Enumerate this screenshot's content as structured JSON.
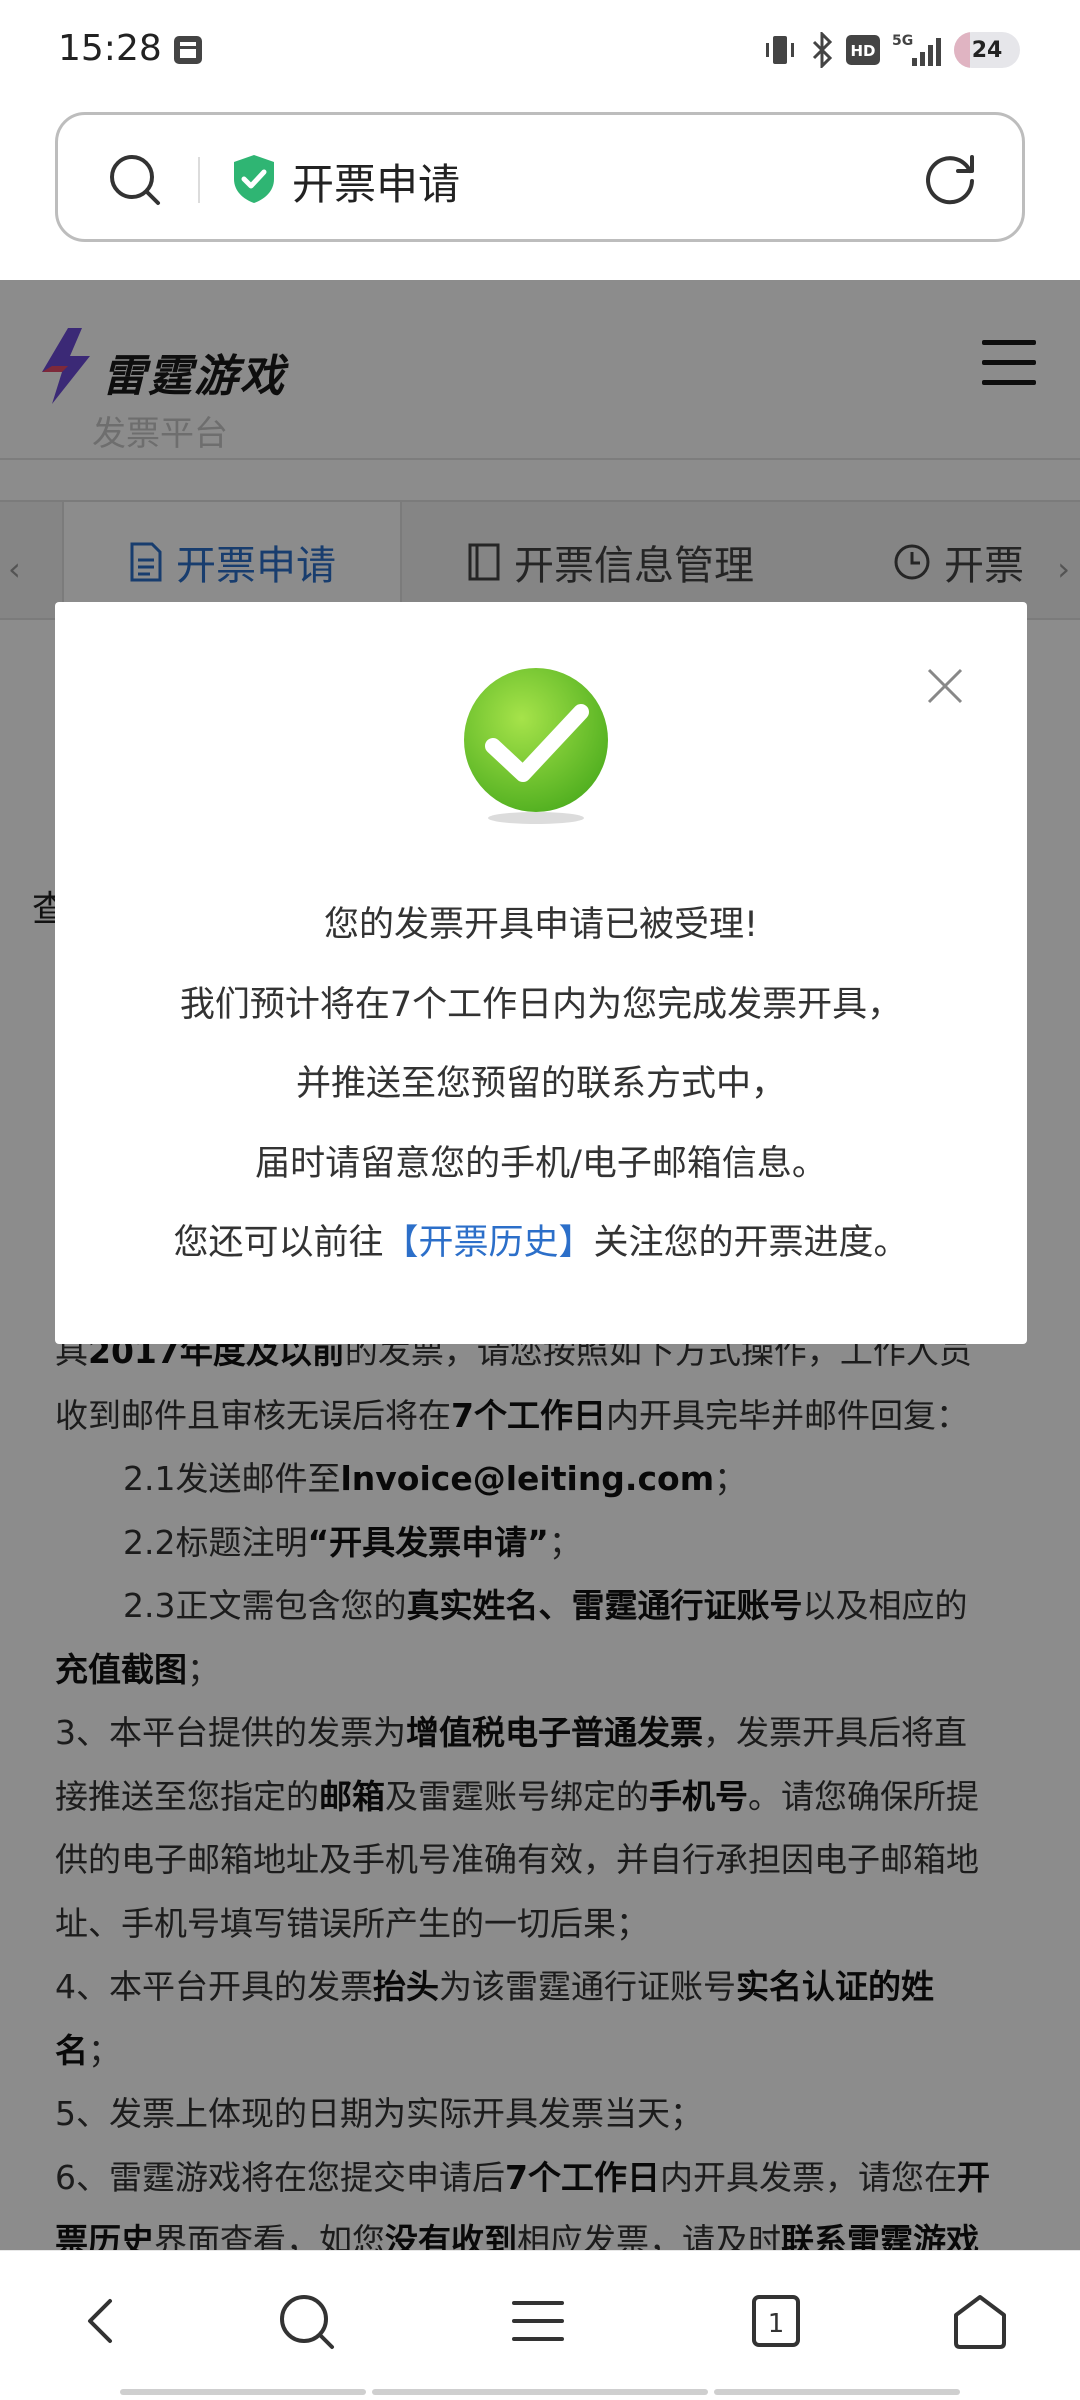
{
  "status_bar": {
    "time": "15:28",
    "battery_level": "24",
    "icons": [
      "notification-icon",
      "vibrate-icon",
      "bluetooth-icon",
      "hd-icon",
      "5g-signal-icon",
      "battery-icon"
    ],
    "badges": {
      "hd": "HD",
      "net": "5G"
    }
  },
  "address_bar": {
    "title": "开票申请",
    "icons": [
      "search-icon",
      "shield-check-icon",
      "reload-icon"
    ]
  },
  "site": {
    "logo_text": "雷霆游戏",
    "logo_subtitle": "发票平台",
    "menu_icon": "hamburger-icon"
  },
  "tabs": [
    {
      "label": "开票申请",
      "icon": "document-icon",
      "active": true
    },
    {
      "label": "开票信息管理",
      "icon": "book-icon",
      "active": false
    },
    {
      "label": "开票",
      "icon": "clock-icon",
      "active": false
    }
  ],
  "tabs_nav": {
    "left": "‹",
    "right": "›"
  },
  "partial_char": "查",
  "body_lines": [
    {
      "segments": [
        {
          "t": "具",
          "b": false
        },
        {
          "t": "2017年度及以前",
          "b": true
        },
        {
          "t": "的发票，请您按照如下方式操作，工作人员",
          "b": false
        }
      ]
    },
    {
      "segments": [
        {
          "t": "收到邮件且审核无误后将在",
          "b": false
        },
        {
          "t": "7个工作日",
          "b": true
        },
        {
          "t": "内开具完毕并邮件回复：",
          "b": false
        }
      ]
    },
    {
      "indent": true,
      "segments": [
        {
          "t": "2.1发送邮件至",
          "b": false
        },
        {
          "t": "lnvoice@leiting.com",
          "b": true
        },
        {
          "t": "；",
          "b": false
        }
      ]
    },
    {
      "indent": true,
      "segments": [
        {
          "t": "2.2标题注明",
          "b": false
        },
        {
          "t": "“开具发票申请”",
          "b": true
        },
        {
          "t": "；",
          "b": false
        }
      ]
    },
    {
      "indent": true,
      "segments": [
        {
          "t": "2.3正文需包含您的",
          "b": false
        },
        {
          "t": "真实姓名、雷霆通行证账号",
          "b": true
        },
        {
          "t": "以及相应的",
          "b": false
        }
      ]
    },
    {
      "segments": [
        {
          "t": "充值截图",
          "b": true
        },
        {
          "t": "；",
          "b": false
        }
      ]
    },
    {
      "segments": [
        {
          "t": "3、本平台提供的发票为",
          "b": false
        },
        {
          "t": "增值税电子普通发票",
          "b": true
        },
        {
          "t": "，发票开具后将直",
          "b": false
        }
      ]
    },
    {
      "segments": [
        {
          "t": "接推送至您指定的",
          "b": false
        },
        {
          "t": "邮箱",
          "b": true
        },
        {
          "t": "及雷霆账号绑定的",
          "b": false
        },
        {
          "t": "手机号",
          "b": true
        },
        {
          "t": "。请您确保所提",
          "b": false
        }
      ]
    },
    {
      "segments": [
        {
          "t": "供的电子邮箱地址及手机号准确有效，并自行承担因电子邮箱地",
          "b": false
        }
      ]
    },
    {
      "segments": [
        {
          "t": "址、手机号填写错误所产生的一切后果；",
          "b": false
        }
      ]
    },
    {
      "segments": [
        {
          "t": "4、本平台开具的发票",
          "b": false
        },
        {
          "t": "抬头",
          "b": true
        },
        {
          "t": "为该雷霆通行证账号",
          "b": false
        },
        {
          "t": "实名认证的姓",
          "b": true
        }
      ]
    },
    {
      "segments": [
        {
          "t": "名",
          "b": true
        },
        {
          "t": "；",
          "b": false
        }
      ]
    },
    {
      "segments": [
        {
          "t": "5、发票上体现的日期为实际开具发票当天；",
          "b": false
        }
      ]
    },
    {
      "segments": [
        {
          "t": "6、雷霆游戏将在您提交申请后",
          "b": false
        },
        {
          "t": "7个工作日",
          "b": true
        },
        {
          "t": "内开具发票，请您在",
          "b": false
        },
        {
          "t": "开",
          "b": true
        }
      ]
    },
    {
      "segments": [
        {
          "t": "票历史",
          "b": true
        },
        {
          "t": "界面查看，如您",
          "b": false
        },
        {
          "t": "没有收到",
          "b": true
        },
        {
          "t": "相应发票，请及时",
          "b": false
        },
        {
          "t": "联系雷霆游戏",
          "b": true
        }
      ]
    }
  ],
  "modal": {
    "icon": "success-check-icon",
    "close_icon": "close-icon",
    "line1": "您的发票开具申请已被受理!",
    "line2": "我们预计将在7个工作日内为您完成发票开具，",
    "line3": "并推送至您预留的联系方式中，",
    "line4": "届时请留意您的手机/电子邮箱信息。",
    "line5_prefix": "您还可以前往",
    "line5_link": "【开票历史】",
    "line5_suffix": "关注您的开票进度。"
  },
  "bottom_nav": {
    "items": [
      "back-icon",
      "search-icon",
      "menu-icon",
      "tabs-icon",
      "home-icon"
    ],
    "tab_count": "1"
  },
  "colors": {
    "accent": "#2c6fc9",
    "success": "#6fca2f",
    "shield": "#2fb573"
  }
}
